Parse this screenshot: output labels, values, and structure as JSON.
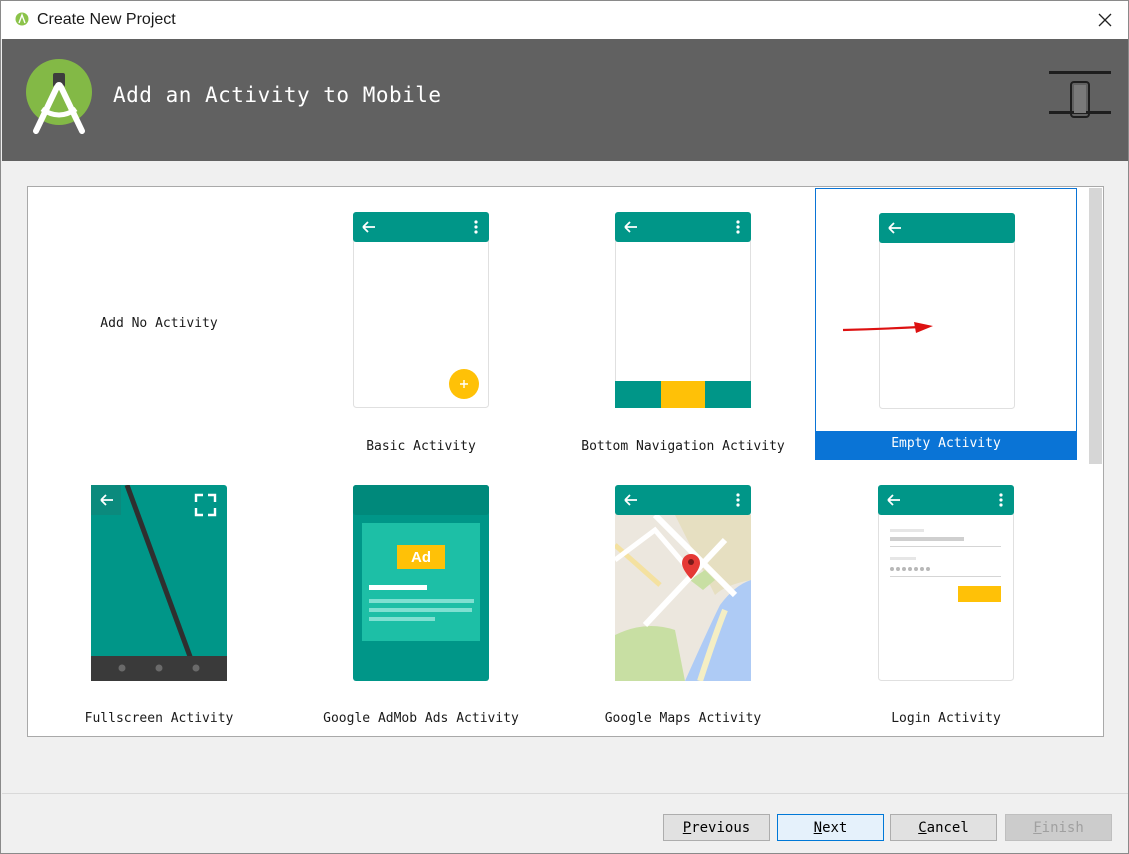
{
  "window": {
    "title": "Create New Project"
  },
  "header": {
    "heading": "Add an Activity to Mobile"
  },
  "activities": [
    {
      "label": "Add No Activity"
    },
    {
      "label": "Basic Activity"
    },
    {
      "label": "Bottom Navigation Activity"
    },
    {
      "label": "Empty Activity"
    },
    {
      "label": "Fullscreen Activity"
    },
    {
      "label": "Google AdMob Ads Activity"
    },
    {
      "label": "Google Maps Activity"
    },
    {
      "label": "Login Activity"
    }
  ],
  "selected_activity": "Empty Activity",
  "admob": {
    "badge": "Ad"
  },
  "buttons": {
    "previous": {
      "mnemonic": "P",
      "rest": "revious"
    },
    "next": {
      "mnemonic": "N",
      "rest": "ext"
    },
    "cancel": {
      "mnemonic": "C",
      "rest": "ancel"
    },
    "finish": {
      "mnemonic": "F",
      "rest": "inish"
    }
  },
  "colors": {
    "header_bg": "#616161",
    "teal": "#009688",
    "amber": "#FFC107",
    "selection": "#0A74D6",
    "android_green": "#8BC34A"
  },
  "icons": [
    "android-studio-logo-icon",
    "close-icon",
    "device-form-factor-icon",
    "back-arrow-icon",
    "overflow-menu-icon",
    "fab-plus-icon",
    "fullscreen-icon",
    "map-pin-icon",
    "red-arrow-annotation"
  ]
}
